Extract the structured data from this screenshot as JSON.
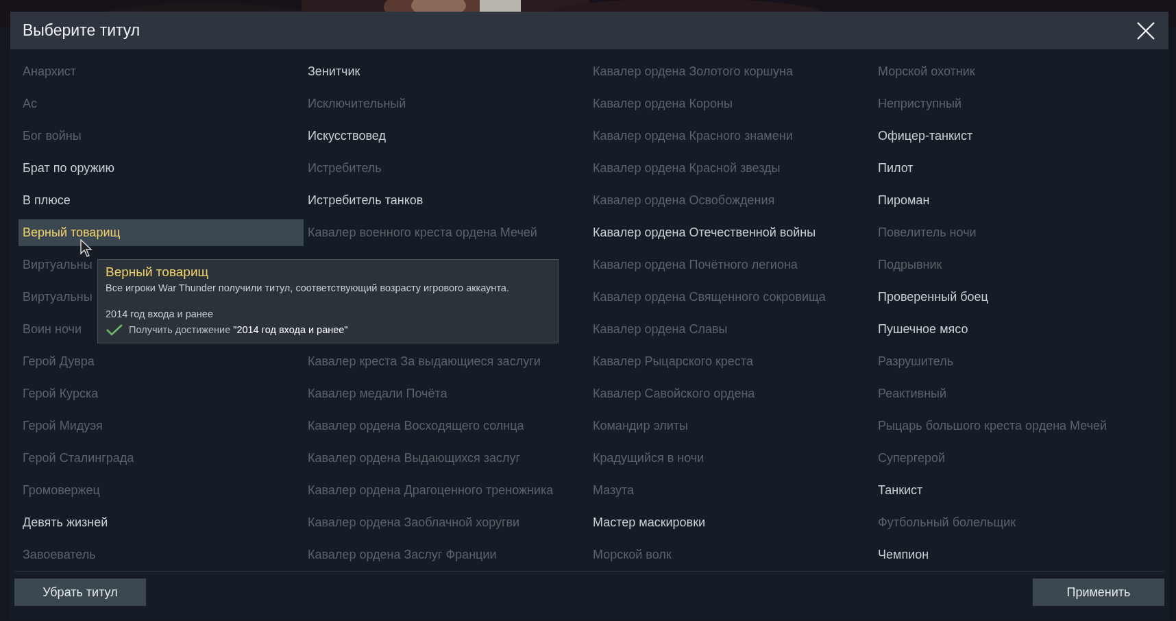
{
  "dialog": {
    "title": "Выберите титул"
  },
  "columns": [
    {
      "groups": [
        [
          {
            "label": "Анархист",
            "unlocked": false,
            "selected": false
          },
          {
            "label": "Ас",
            "unlocked": false,
            "selected": false
          },
          {
            "label": "Бог войны",
            "unlocked": false,
            "selected": false
          },
          {
            "label": "Брат по оружию",
            "unlocked": true,
            "selected": false
          },
          {
            "label": "В плюсе",
            "unlocked": true,
            "selected": false
          },
          {
            "label": "Верный товарищ",
            "unlocked": true,
            "selected": true
          },
          {
            "label": "Виртуальны",
            "unlocked": false,
            "selected": false
          },
          {
            "label": "Виртуальны",
            "unlocked": false,
            "selected": false
          },
          {
            "label": "Воин ночи",
            "unlocked": false,
            "selected": false
          },
          {
            "label": "Герой Дувра",
            "unlocked": false,
            "selected": false
          },
          {
            "label": "Герой Курска",
            "unlocked": false,
            "selected": false
          },
          {
            "label": "Герой Мидуэя",
            "unlocked": false,
            "selected": false
          },
          {
            "label": "Герой Сталинграда",
            "unlocked": false,
            "selected": false
          },
          {
            "label": "Громовержец",
            "unlocked": false,
            "selected": false
          },
          {
            "label": "Девять жизней",
            "unlocked": true,
            "selected": false
          },
          {
            "label": "Завоеватель",
            "unlocked": false,
            "selected": false
          }
        ]
      ]
    },
    {
      "groups": [
        [
          {
            "label": "Зенитчик",
            "unlocked": true,
            "selected": false
          },
          {
            "label": "Исключительный",
            "unlocked": false,
            "selected": false
          },
          {
            "label": "Искусствовед",
            "unlocked": true,
            "selected": false
          },
          {
            "label": "Истребитель",
            "unlocked": false,
            "selected": false
          },
          {
            "label": "Истребитель танков",
            "unlocked": true,
            "selected": false
          },
          {
            "label": "Кавалер военного креста ордена Мечей",
            "unlocked": false,
            "selected": false
          }
        ],
        [
          {
            "label": "Кавалер креста За выдающиеся заслуги",
            "unlocked": false,
            "selected": false
          },
          {
            "label": "Кавалер медали Почёта",
            "unlocked": false,
            "selected": false
          },
          {
            "label": "Кавалер ордена Восходящего солнца",
            "unlocked": false,
            "selected": false
          },
          {
            "label": "Кавалер ордена Выдающихся заслуг",
            "unlocked": false,
            "selected": false
          },
          {
            "label": "Кавалер ордена Драгоценного треножника",
            "unlocked": false,
            "selected": false
          },
          {
            "label": "Кавалер ордена Заоблачной хоругви",
            "unlocked": false,
            "selected": false
          },
          {
            "label": "Кавалер ордена Заслуг Франции",
            "unlocked": false,
            "selected": false
          }
        ]
      ]
    },
    {
      "groups": [
        [
          {
            "label": "Кавалер ордена Золотого коршуна",
            "unlocked": false,
            "selected": false
          },
          {
            "label": "Кавалер ордена Короны",
            "unlocked": false,
            "selected": false
          },
          {
            "label": "Кавалер ордена Красного знамени",
            "unlocked": false,
            "selected": false
          },
          {
            "label": "Кавалер ордена Красной звезды",
            "unlocked": false,
            "selected": false
          },
          {
            "label": "Кавалер ордена Освобождения",
            "unlocked": false,
            "selected": false
          },
          {
            "label": "Кавалер ордена Отечественной войны",
            "unlocked": true,
            "selected": false
          },
          {
            "label": "Кавалер ордена Почётного легиона",
            "unlocked": false,
            "selected": false
          },
          {
            "label": "Кавалер ордена Священного сокровища",
            "unlocked": false,
            "selected": false
          },
          {
            "label": "Кавалер ордена Славы",
            "unlocked": false,
            "selected": false
          },
          {
            "label": "Кавалер Рыцарского креста",
            "unlocked": false,
            "selected": false
          },
          {
            "label": "Кавалер Савойского ордена",
            "unlocked": false,
            "selected": false
          },
          {
            "label": "Командир элиты",
            "unlocked": false,
            "selected": false
          },
          {
            "label": "Крадущийся в ночи",
            "unlocked": false,
            "selected": false
          },
          {
            "label": "Мазута",
            "unlocked": false,
            "selected": false
          },
          {
            "label": "Мастер маскировки",
            "unlocked": true,
            "selected": false
          },
          {
            "label": "Морской волк",
            "unlocked": false,
            "selected": false
          }
        ]
      ]
    },
    {
      "groups": [
        [
          {
            "label": "Морской охотник",
            "unlocked": false,
            "selected": false
          },
          {
            "label": "Неприступный",
            "unlocked": false,
            "selected": false
          },
          {
            "label": "Офицер-танкист",
            "unlocked": true,
            "selected": false
          },
          {
            "label": "Пилот",
            "unlocked": true,
            "selected": false
          },
          {
            "label": "Пироман",
            "unlocked": true,
            "selected": false
          },
          {
            "label": "Повелитель ночи",
            "unlocked": false,
            "selected": false
          },
          {
            "label": "Подрывник",
            "unlocked": false,
            "selected": false
          },
          {
            "label": "Проверенный боец",
            "unlocked": true,
            "selected": false
          },
          {
            "label": "Пушечное мясо",
            "unlocked": true,
            "selected": false
          },
          {
            "label": "Разрушитель",
            "unlocked": false,
            "selected": false
          },
          {
            "label": "Реактивный",
            "unlocked": false,
            "selected": false
          },
          {
            "label": "Рыцарь большого креста ордена Мечей",
            "unlocked": false,
            "selected": false
          },
          {
            "label": "Супергерой",
            "unlocked": false,
            "selected": false
          },
          {
            "label": "Танкист",
            "unlocked": true,
            "selected": false
          },
          {
            "label": "Футбольный болельщик",
            "unlocked": false,
            "selected": false
          },
          {
            "label": "Чемпион",
            "unlocked": true,
            "selected": false
          }
        ]
      ]
    }
  ],
  "tooltip": {
    "title": "Верный товарищ",
    "description": "Все игроки War Thunder получили титул, соответствующий возрасту игрового аккаунта.",
    "condition": "2014 год входа и ранее",
    "requirement": {
      "text": "Получить достижение **\"2014 год входа и ранее\"**",
      "done": true
    }
  },
  "buttons": {
    "left": "Убрать титул",
    "right": "Применить"
  }
}
